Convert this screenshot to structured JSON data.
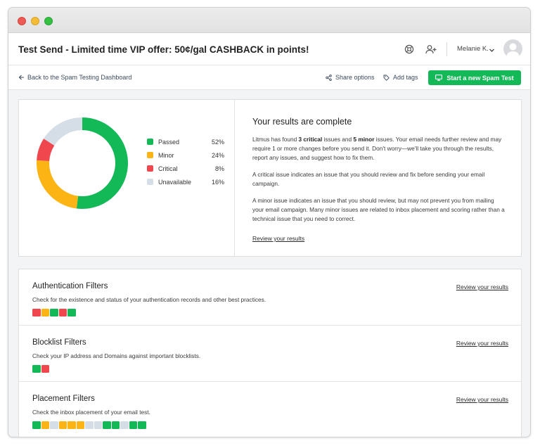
{
  "header": {
    "title": "Test Send - Limited time VIP offer: 50¢/gal CASHBACK in points!",
    "user_name": "Melanie K."
  },
  "subbar": {
    "back_label": "Back to the Spam Testing Dashboard",
    "share_label": "Share options",
    "tags_label": "Add tags",
    "new_test_label": "Start a new Spam Test"
  },
  "colors": {
    "passed": "#13b857",
    "minor": "#fbb414",
    "critical": "#f0474f",
    "unavailable": "#d5dee6"
  },
  "chart_data": {
    "type": "pie",
    "labels": [
      "Passed",
      "Minor",
      "Critical",
      "Unavailable"
    ],
    "values": [
      52,
      24,
      8,
      16
    ]
  },
  "legend": [
    {
      "label": "Passed",
      "pct": "52%"
    },
    {
      "label": "Minor",
      "pct": "24%"
    },
    {
      "label": "Critical",
      "pct": "8%"
    },
    {
      "label": "Unavailable",
      "pct": "16%"
    }
  ],
  "results": {
    "heading": "Your results are complete",
    "p1_pre": "Litmus has found ",
    "p1_critical": "3 critical",
    "p1_mid": " issues and ",
    "p1_minor": "5 minor",
    "p1_post": " issues. Your email needs further review and may require 1 or more changes before you send it. Don't worry—we'll take you through the results, report any issues, and suggest how to fix them.",
    "p2": "A critical issue indicates an issue that you should review and fix before sending your email campaign.",
    "p3": "A minor issue indicates an issue that you should review, but may not prevent you from mailing your email campaign. Many minor issues are related to inbox placement and scoring rather than a technical issue that you need to correct.",
    "link": "Review your results"
  },
  "filters": [
    {
      "title": "Authentication Filters",
      "desc": "Check for the existence and status of your authentication records and other best practices.",
      "link": "Review your results",
      "squares": [
        "critical",
        "minor",
        "passed",
        "critical",
        "passed"
      ]
    },
    {
      "title": "Blocklist Filters",
      "desc": "Check your IP address and Domains against important blocklists.",
      "link": "Review your results",
      "squares": [
        "passed",
        "critical"
      ]
    },
    {
      "title": "Placement Filters",
      "desc": "Check the inbox placement of your email test.",
      "link": "Review your results",
      "squares": [
        "passed",
        "minor",
        "unavailable",
        "minor",
        "minor",
        "minor",
        "unavailable",
        "unavailable",
        "passed",
        "passed",
        "unavailable",
        "passed",
        "passed"
      ]
    }
  ]
}
